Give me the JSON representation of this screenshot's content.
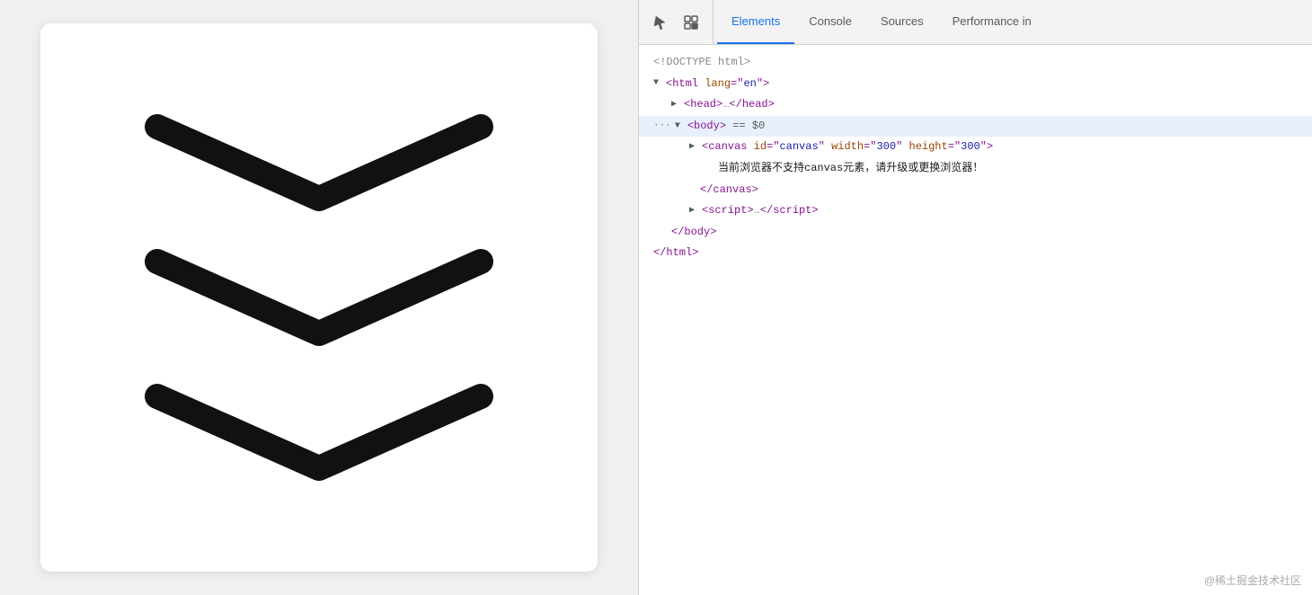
{
  "left": {
    "chevrons": [
      {
        "id": "chevron-1"
      },
      {
        "id": "chevron-2"
      },
      {
        "id": "chevron-3"
      }
    ]
  },
  "devtools": {
    "toolbar": {
      "tabs": [
        {
          "label": "Elements",
          "active": true
        },
        {
          "label": "Console",
          "active": false
        },
        {
          "label": "Sources",
          "active": false
        },
        {
          "label": "Performance in",
          "active": false
        }
      ]
    },
    "code": {
      "line1": "<!DOCTYPE html>",
      "line2_open": "<html lang=\"en\">",
      "line3": "<head>…</head>",
      "line4_body": "<body>",
      "line4_eq": "==",
      "line4_dollar": "$0",
      "line5_canvas_open": "<canvas id=\"canvas\" width=\"300\" height=\"300\">",
      "line6_text": "当前浏览器不支持canvas元素，请升级或更换浏览器！",
      "line7_canvas_close": "</canvas>",
      "line8_script": "<script>…</script>",
      "line9_body_close": "</body>",
      "line10_html_close": "</html>"
    },
    "watermark": "@稀土掘金技术社区"
  }
}
